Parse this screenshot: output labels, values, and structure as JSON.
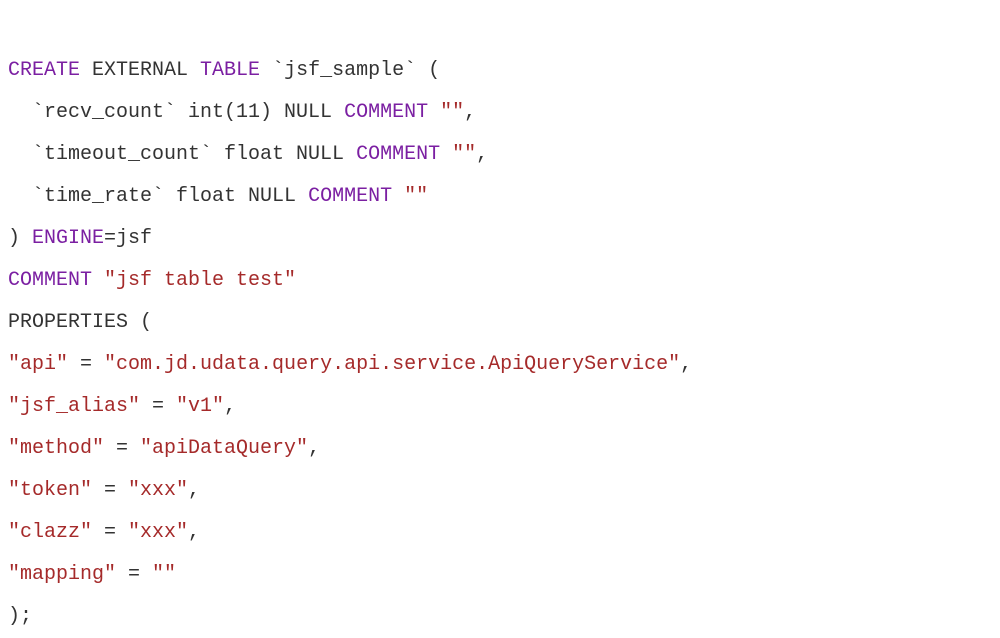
{
  "code": {
    "l1_kw1": "CREATE",
    "l1_txt1": " EXTERNAL ",
    "l1_kw2": "TABLE",
    "l1_txt2": " `jsf_sample` (",
    "l2_txt1": "  `recv_count` int(11) NULL ",
    "l2_kw1": "COMMENT",
    "l2_txt2": " ",
    "l2_str1": "\"\"",
    "l2_txt3": ",",
    "l3_txt1": "  `timeout_count` float NULL ",
    "l3_kw1": "COMMENT",
    "l3_txt2": " ",
    "l3_str1": "\"\"",
    "l3_txt3": ",",
    "l4_txt1": "  `time_rate` float NULL ",
    "l4_kw1": "COMMENT",
    "l4_txt2": " ",
    "l4_str1": "\"\"",
    "l5_txt1": ") ",
    "l5_kw1": "ENGINE",
    "l5_txt2": "=jsf",
    "l6_kw1": "COMMENT",
    "l6_txt1": " ",
    "l6_str1": "\"jsf table test\"",
    "l7_txt1": "PROPERTIES (",
    "l8_str1": "\"api\"",
    "l8_txt1": " = ",
    "l8_str2": "\"com.jd.udata.query.api.service.ApiQueryService\"",
    "l8_txt2": ",",
    "l9_str1": "\"jsf_alias\"",
    "l9_txt1": " = ",
    "l9_str2": "\"v1\"",
    "l9_txt2": ",",
    "l10_str1": "\"method\"",
    "l10_txt1": " = ",
    "l10_str2": "\"apiDataQuery\"",
    "l10_txt2": ",",
    "l11_str1": "\"token\"",
    "l11_txt1": " = ",
    "l11_str2": "\"xxx\"",
    "l11_txt2": ",",
    "l12_str1": "\"clazz\"",
    "l12_txt1": " = ",
    "l12_str2": "\"xxx\"",
    "l12_txt2": ",",
    "l13_str1": "\"mapping\"",
    "l13_txt1": " = ",
    "l13_str2": "\"\"",
    "l14_txt1": ");"
  }
}
